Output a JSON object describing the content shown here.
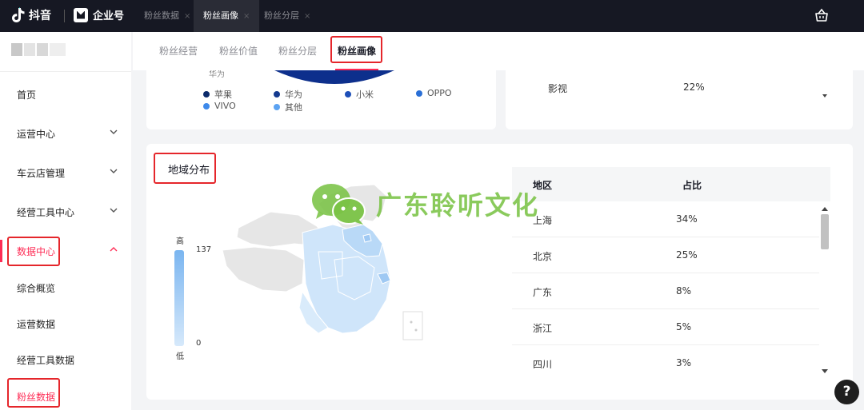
{
  "topbar": {
    "brand": "抖音",
    "brand2": "企业号",
    "tabs": [
      {
        "label": "粉丝数据"
      },
      {
        "label": "粉丝画像"
      },
      {
        "label": "粉丝分层"
      }
    ],
    "close_glyph": "×"
  },
  "sidebar": {
    "items": [
      {
        "label": "首页"
      },
      {
        "label": "运营中心"
      },
      {
        "label": "车云店管理"
      },
      {
        "label": "经营工具中心"
      },
      {
        "label": "数据中心"
      }
    ],
    "subitems": [
      {
        "label": "综合概览"
      },
      {
        "label": "运营数据"
      },
      {
        "label": "经营工具数据"
      },
      {
        "label": "粉丝数据"
      }
    ]
  },
  "subtabs": [
    {
      "label": "粉丝经营"
    },
    {
      "label": "粉丝价值"
    },
    {
      "label": "粉丝分层"
    },
    {
      "label": "粉丝画像"
    }
  ],
  "device_card": {
    "cropped_label": "华为",
    "legend": [
      {
        "label": "苹果",
        "color": "#0b2a6b"
      },
      {
        "label": "华为",
        "color": "#143a8f"
      },
      {
        "label": "小米",
        "color": "#1d4fb8"
      },
      {
        "label": "OPPO",
        "color": "#2a6fd6"
      },
      {
        "label": "VIVO",
        "color": "#3d89ea"
      },
      {
        "label": "其他",
        "color": "#5ca3f2"
      }
    ]
  },
  "interest_card": {
    "row": {
      "name": "影视",
      "value": "22%"
    }
  },
  "region_card": {
    "title": "地域分布",
    "legend_high": "高",
    "legend_low": "低",
    "legend_max": "137",
    "legend_min": "0",
    "table": {
      "headers": [
        "地区",
        "占比"
      ],
      "rows": [
        {
          "name": "上海",
          "value": "34%"
        },
        {
          "name": "北京",
          "value": "25%"
        },
        {
          "name": "广东",
          "value": "8%"
        },
        {
          "name": "浙江",
          "value": "5%"
        },
        {
          "name": "四川",
          "value": "3%"
        }
      ]
    }
  },
  "watermark": "广东聆听文化",
  "help": "?"
}
